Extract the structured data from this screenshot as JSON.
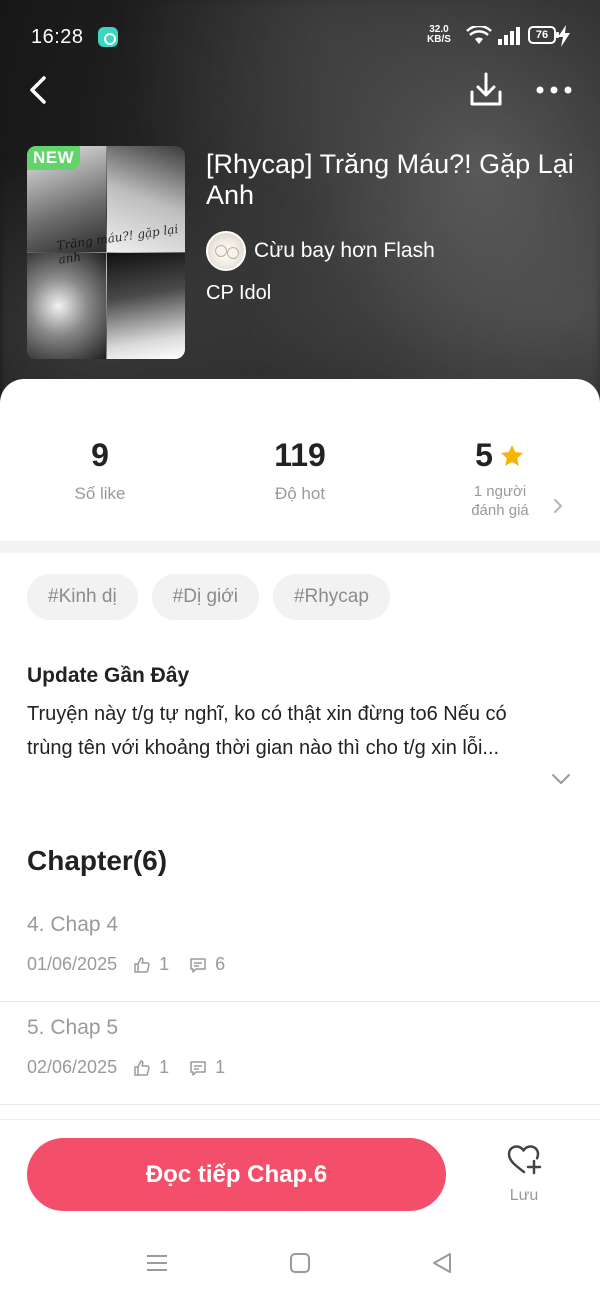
{
  "status_bar": {
    "time": "16:28",
    "net_speed_value": "32.0",
    "net_speed_unit": "KB/S",
    "battery": "76"
  },
  "story": {
    "badge": "NEW",
    "title": "[Rhycap] Trăng Máu?! Gặp Lại Anh",
    "author": "Cừu bay hơn Flash",
    "category": "CP Idol",
    "cover_script": "Trăng máu?! gặp lại anh"
  },
  "stats": {
    "likes_value": "9",
    "likes_label": "Số like",
    "hot_value": "119",
    "hot_label": "Độ hot",
    "rating_value": "5",
    "rating_label_line1": "1 người",
    "rating_label_line2": "đánh giá"
  },
  "tags": [
    "#Kinh dị",
    "#Dị giới",
    "#Rhycap"
  ],
  "update": {
    "title": "Update Gần Đây",
    "body": "Truyện này t/g tự nghĩ, ko có thật xin đừng to6 Nếu có trùng tên với khoảng thời gian nào thì cho t/g xin lỗi..."
  },
  "chapters": {
    "header": "Chapter(6)",
    "items": [
      {
        "name": "4. Chap 4",
        "date": "01/06/2025",
        "likes": "1",
        "comments": "6"
      },
      {
        "name": "5. Chap 5",
        "date": "02/06/2025",
        "likes": "1",
        "comments": "1"
      }
    ]
  },
  "actions": {
    "read_button": "Đọc tiếp Chap.6",
    "save_label": "Lưu"
  },
  "colors": {
    "accent": "#f44f6a",
    "badge_new": "#62d46a",
    "star": "#f7b500"
  },
  "icons": {
    "back": "chevron-left-icon",
    "download": "download-icon",
    "more": "more-horizontal-icon",
    "star": "star-icon",
    "like": "thumbs-up-icon",
    "comment": "comment-icon",
    "save": "heart-plus-icon"
  }
}
